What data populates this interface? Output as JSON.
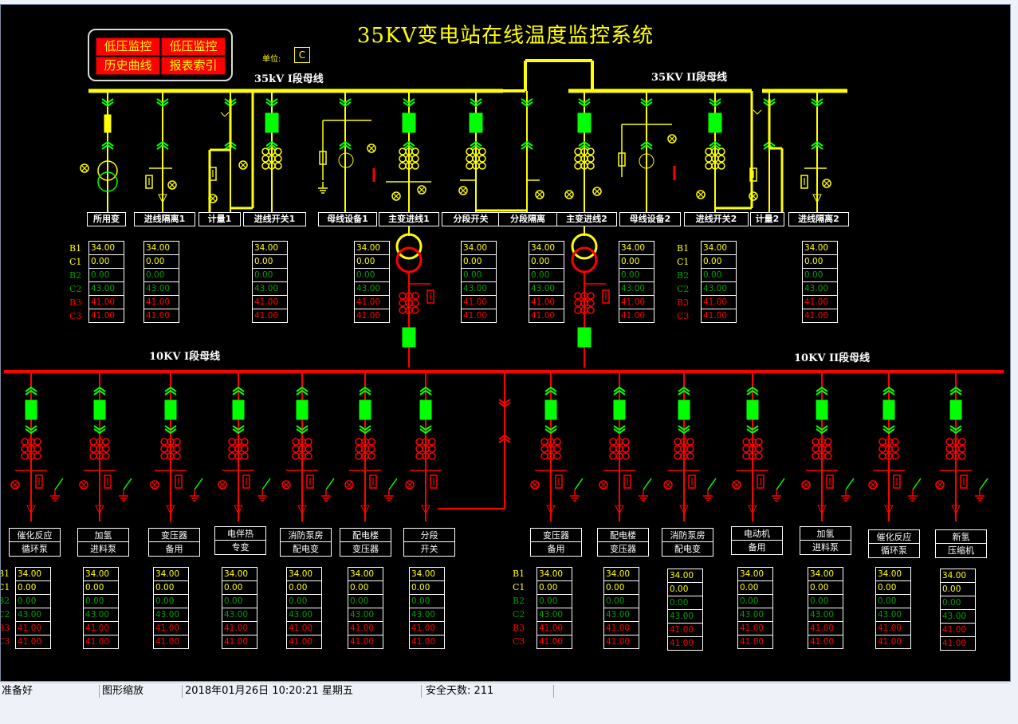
{
  "app": {
    "title": "35KV变电站在线温度监控系统"
  },
  "nav": {
    "buttons": [
      {
        "label": "低压监控"
      },
      {
        "label": "低压监控"
      },
      {
        "label": "历史曲线"
      },
      {
        "label": "报表索引"
      }
    ]
  },
  "unit": {
    "label": "单位:",
    "value": "C"
  },
  "buses": {
    "hv1": "35kV I段母线",
    "hv2": "35KV II段母线",
    "lv1": "10KV I段母线",
    "lv2": "10KV II段母线"
  },
  "hv_feeders": [
    "所用变",
    "进线隔离1",
    "计量1",
    "进线开关1",
    "母线设备1",
    "主变进线1",
    "分段开关",
    "分段隔离",
    "主变进线2",
    "母线设备2",
    "进线开关2",
    "计量2",
    "进线隔离2"
  ],
  "row_labels": [
    "B1",
    "C1",
    "B2",
    "C2",
    "B3",
    "C3"
  ],
  "hv_tables": [
    {
      "values": [
        "34.00",
        "0.00",
        "0.00",
        "43.00",
        "41.00",
        "41.00"
      ]
    },
    {
      "values": [
        "34.00",
        "0.00",
        "0.00",
        "43.00",
        "41.00",
        "41.00"
      ]
    },
    {
      "values": [
        "34.00",
        "0.00",
        "0.00",
        "43.00",
        "41.00",
        "41.00"
      ]
    },
    {
      "values": [
        "34.00",
        "0.00",
        "0.00",
        "43.00",
        "41.00",
        "41.00"
      ]
    },
    {
      "values": [
        "34.00",
        "0.00",
        "0.00",
        "43.00",
        "41.00",
        "41.00"
      ]
    },
    {
      "values": [
        "34.00",
        "0.00",
        "0.00",
        "43.00",
        "41.00",
        "41.00"
      ]
    },
    {
      "values": [
        "34.00",
        "0.00",
        "0.00",
        "43.00",
        "41.00",
        "41.00"
      ]
    },
    {
      "values": [
        "34.00",
        "0.00",
        "0.00",
        "43.00",
        "41.00",
        "41.00"
      ]
    },
    {
      "values": [
        "34.00",
        "0.00",
        "0.00",
        "43.00",
        "41.00",
        "41.00"
      ]
    }
  ],
  "lv_feeders": [
    {
      "line1": "催化反应",
      "line2": "循环泵"
    },
    {
      "line1": "加氢",
      "line2": "进料泵"
    },
    {
      "line1": "变压器",
      "line2": "备用"
    },
    {
      "line1": "电伴热",
      "line2": "专变"
    },
    {
      "line1": "消防泵房",
      "line2": "配电变"
    },
    {
      "line1": "配电楼",
      "line2": "变压器"
    },
    {
      "line1": "分段",
      "line2": "开关"
    },
    {
      "line1": "变压器",
      "line2": "备用"
    },
    {
      "line1": "配电楼",
      "line2": "变压器"
    },
    {
      "line1": "消防泵房",
      "line2": "配电变"
    },
    {
      "line1": "电动机",
      "line2": "备用"
    },
    {
      "line1": "加氢",
      "line2": "进料泵"
    },
    {
      "line1": "催化反应",
      "line2": "循环泵"
    },
    {
      "line1": "新氢",
      "line2": "压缩机"
    }
  ],
  "lv_tables": [
    {
      "values": [
        "34.00",
        "0.00",
        "0.00",
        "43.00",
        "41.00",
        "41.00"
      ]
    },
    {
      "values": [
        "34.00",
        "0.00",
        "0.00",
        "43.00",
        "41.00",
        "41.00"
      ]
    },
    {
      "values": [
        "34.00",
        "0.00",
        "0.00",
        "43.00",
        "41.00",
        "41.00"
      ]
    },
    {
      "values": [
        "34.00",
        "0.00",
        "0.00",
        "43.00",
        "41.00",
        "41.00"
      ]
    },
    {
      "values": [
        "34.00",
        "0.00",
        "0.00",
        "43.00",
        "41.00",
        "41.00"
      ]
    },
    {
      "values": [
        "34.00",
        "0.00",
        "0.00",
        "43.00",
        "41.00",
        "41.00"
      ]
    },
    {
      "values": [
        "34.00",
        "0.00",
        "0.00",
        "43.00",
        "41.00",
        "41.00"
      ]
    },
    {
      "values": [
        "34.00",
        "0.00",
        "0.00",
        "43.00",
        "41.00",
        "41.00"
      ]
    },
    {
      "values": [
        "34.00",
        "0.00",
        "0.00",
        "43.00",
        "41.00",
        "41.00"
      ]
    },
    {
      "values": [
        "34.00",
        "0.00",
        "0.00",
        "43.00",
        "41.00",
        "41.00"
      ]
    },
    {
      "values": [
        "34.00",
        "0.00",
        "0.00",
        "43.00",
        "41.00",
        "41.00"
      ]
    },
    {
      "values": [
        "34.00",
        "0.00",
        "0.00",
        "43.00",
        "41.00",
        "41.00"
      ]
    },
    {
      "values": [
        "34.00",
        "0.00",
        "0.00",
        "43.00",
        "41.00",
        "41.00"
      ]
    },
    {
      "values": [
        "34.00",
        "0.00",
        "0.00",
        "43.00",
        "41.00",
        "41.00"
      ]
    }
  ],
  "status": {
    "ready": "准备好",
    "mode": "图形缩放",
    "datetime": "2018年01月26日  10:20:21   星期五",
    "safe_days": "安全天数: 211"
  },
  "colors": {
    "hv_bus": "#ffff00",
    "lv_bus": "#ff0000",
    "breaker": "#00ff00",
    "background": "#000000"
  }
}
